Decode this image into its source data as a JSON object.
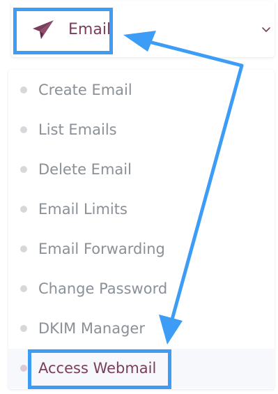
{
  "header": {
    "label": "Email",
    "icon": "paper-plane-icon",
    "chevron": "chevron-down-icon"
  },
  "submenu": {
    "items": [
      {
        "label": "Create Email"
      },
      {
        "label": "List Emails"
      },
      {
        "label": "Delete Email"
      },
      {
        "label": "Email Limits"
      },
      {
        "label": "Email Forwarding"
      },
      {
        "label": "Change Password"
      },
      {
        "label": "DKIM Manager"
      },
      {
        "label": "Access Webmail"
      }
    ],
    "active_index": 7
  },
  "colors": {
    "accent": "#7a3d5c",
    "annotation": "#3d9cf5",
    "muted_text": "#8a9097"
  }
}
